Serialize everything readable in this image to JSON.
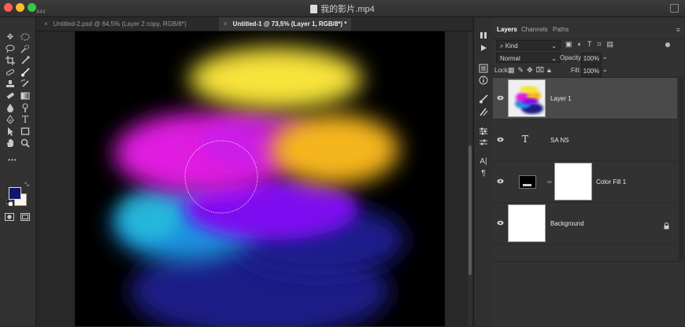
{
  "window": {
    "title": "我的影片.mp4",
    "counter": "444"
  },
  "tabs": [
    {
      "label": "Untitled-2.psd @ 64,5% (Layer 2 copy, RGB/8*)",
      "close": "×"
    },
    {
      "label": "Untitled-1 @ 73,5% (Layer 1, RGB/8*) *",
      "close": "×"
    }
  ],
  "colors": {
    "foreground": "#12166b",
    "background": "#fbf6ea",
    "blobs": [
      "#f7e33a",
      "#e01ee0",
      "#f5b51c",
      "#2aa6e4",
      "#7b10f0",
      "#1a1e86"
    ]
  },
  "toolbar": {
    "tools": [
      "move-tool",
      "marquee-tool",
      "lasso-tool",
      "quick-select-tool",
      "crop-tool",
      "eyedropper-tool",
      "healing-brush-tool",
      "brush-tool",
      "stamp-tool",
      "history-brush-tool",
      "eraser-tool",
      "gradient-tool",
      "blur-tool",
      "dodge-tool",
      "pen-tool",
      "type-tool",
      "path-select-tool",
      "shape-tool",
      "hand-tool",
      "zoom-tool"
    ],
    "more_label": "•••"
  },
  "dock": {
    "icons": [
      "play-icon",
      "info-icon",
      "brush-settings-icon",
      "adjustments-icon",
      "character-icon",
      "paragraph-icon"
    ]
  },
  "layers_panel": {
    "tabs": [
      "Layers",
      "Channels",
      "Paths"
    ],
    "menu": "≡",
    "filter_kind": "Kind",
    "blend_mode": "Normal",
    "opacity_label": "Opacity:",
    "opacity_value": "100%",
    "lock_label": "Lock:",
    "fill_label": "Fill:",
    "fill_value": "100%",
    "layers": [
      {
        "name": "Layer 1",
        "type": "pixel",
        "visible": true,
        "selected": true
      },
      {
        "name": "SA NS",
        "type": "text",
        "visible": true,
        "selected": false,
        "type_glyph": "T"
      },
      {
        "name": "Color Fill 1",
        "type": "fill",
        "visible": true,
        "selected": false
      },
      {
        "name": "Background",
        "type": "background",
        "visible": true,
        "selected": false,
        "locked": true
      }
    ]
  }
}
